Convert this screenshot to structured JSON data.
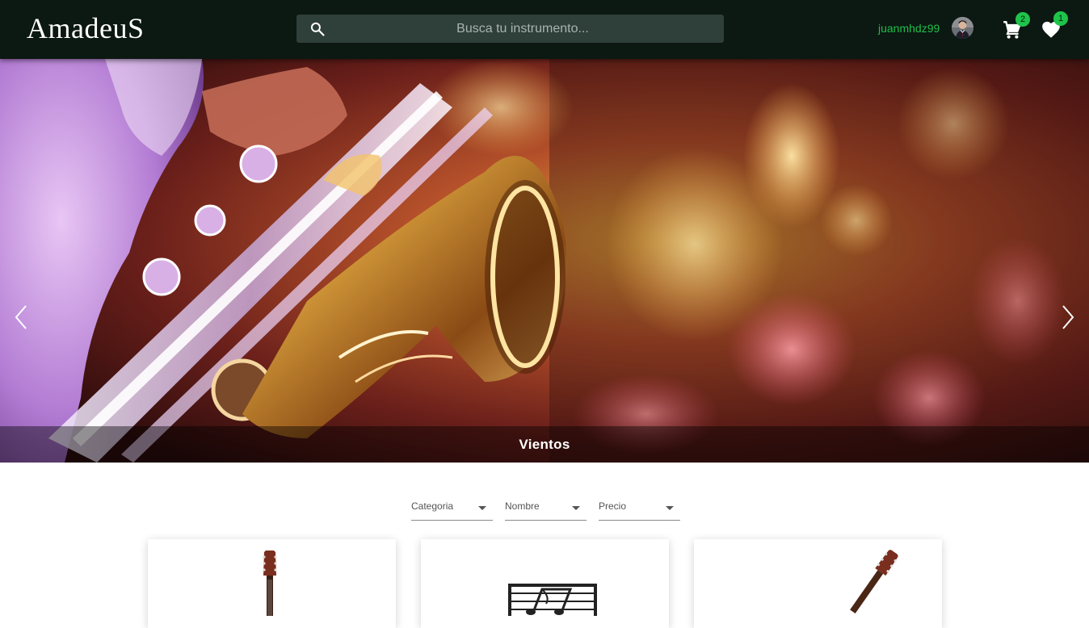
{
  "header": {
    "logo": "AmadeuS",
    "search": {
      "placeholder": "Busca tu instrumento..."
    },
    "user": {
      "username": "juanmhdz99"
    },
    "cart": {
      "count": "2"
    },
    "favorites": {
      "count": "1"
    }
  },
  "carousel": {
    "caption": "Vientos"
  },
  "filters": [
    {
      "label": "Categoria"
    },
    {
      "label": "Nombre"
    },
    {
      "label": "Precio"
    }
  ],
  "colors": {
    "header_bg": "#0c1812",
    "accent_green": "#1ec44a",
    "search_bg": "#2f3f3a"
  },
  "icons": {
    "search": "search-icon",
    "cart": "cart-icon",
    "favorites": "heart-icon",
    "prev": "chevron-left-icon",
    "next": "chevron-right-icon"
  }
}
